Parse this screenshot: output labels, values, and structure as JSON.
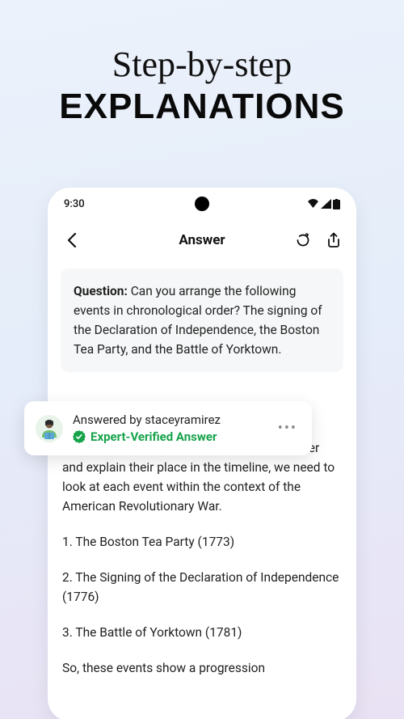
{
  "promo": {
    "line1": "Step-by-step",
    "line2": "EXPLANATIONS"
  },
  "statusbar": {
    "time": "9:30"
  },
  "header": {
    "title": "Answer"
  },
  "question": {
    "label": "Question:",
    "text": " Can you arrange the following events in chronological order? The signing of the Declaration of Independence, the Boston Tea Party, and the Battle of Yorktown."
  },
  "answered_card": {
    "by_prefix": "Answered by ",
    "username": "staceyramirez",
    "verified_label": "Expert-Verified Answer"
  },
  "answer": {
    "intro": "To arrange these events in chronological order and explain their place in the timeline, we need to look at each event within the context of the American Revolutionary War.",
    "item1": "1. The Boston Tea Party (1773)",
    "item2": "2. The Signing of the Declaration of Independence (1776)",
    "item3": "3. The Battle of Yorktown (1781)",
    "outro": "So, these events show a progression"
  },
  "colors": {
    "verified_green": "#16a34a"
  }
}
